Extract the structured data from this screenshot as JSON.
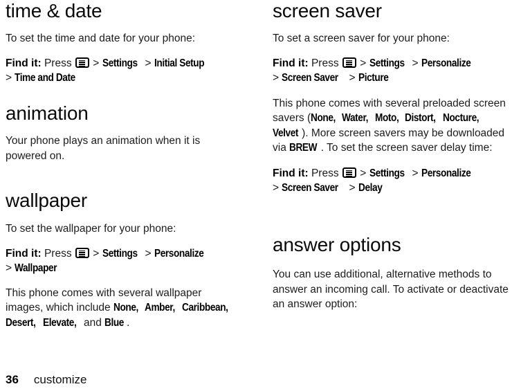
{
  "document": {
    "type": "user-guide-page",
    "footer": {
      "page_number": "36",
      "chapter": "customize"
    }
  },
  "icons": {
    "menu_key": "menu-key-icon"
  },
  "left_column": {
    "sections": [
      {
        "id": "time-and-date",
        "heading": "time & date",
        "intro": "To set the time and date for your phone:",
        "find_it": {
          "lead": "Find it:",
          "press": "Press",
          "icon": "menu-key-icon",
          "path": [
            "Settings",
            "Initial Setup",
            "Time and Date"
          ]
        }
      },
      {
        "id": "animation",
        "heading": "animation",
        "intro": "Your phone plays an animation when it is powered on."
      },
      {
        "id": "wallpaper",
        "heading": "wallpaper",
        "intro": "To set the wallpaper for your phone:",
        "find_it": {
          "lead": "Find it:",
          "press": "Press",
          "icon": "menu-key-icon",
          "path": [
            "Settings",
            "Personalize",
            "Wallpaper"
          ]
        },
        "note_prefix": "This phone comes with several wallpaper images, which include ",
        "note_terms": [
          "None,",
          "Amber,",
          "Caribbean,",
          "Desert,",
          "Elevate,"
        ],
        "note_mid": "and ",
        "note_last_term": "Blue",
        "note_suffix": "."
      }
    ]
  },
  "right_column": {
    "sections": [
      {
        "id": "screen-saver",
        "heading": "screen saver",
        "intro": "To set a screen saver for your phone:",
        "find_it": {
          "lead": "Find it:",
          "press": "Press",
          "icon": "menu-key-icon",
          "path": [
            "Settings",
            "Personalize",
            "Screen Saver",
            "Picture"
          ]
        },
        "note_prefix": "This phone comes with several preloaded screen savers (",
        "note_terms": [
          "None,",
          "Water,",
          "Moto,",
          "Distort,",
          "Nocture,",
          "Velvet"
        ],
        "note_mid": "). More screen savers may be downloaded via ",
        "note_last_term": "BREW",
        "note_suffix": ". To set the screen saver delay time:",
        "find_it_2": {
          "lead": "Find it:",
          "press": "Press",
          "icon": "menu-key-icon",
          "path": [
            "Settings",
            "Personalize",
            "Screen Saver",
            "Delay"
          ]
        }
      },
      {
        "id": "answer-options",
        "heading": "answer options",
        "intro": "You can use additional, alternative methods to answer an incoming call. To activate or deactivate an answer option:"
      }
    ]
  }
}
